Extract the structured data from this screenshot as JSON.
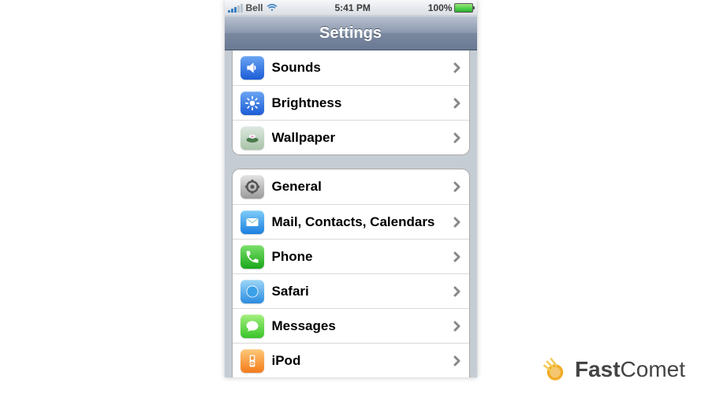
{
  "status_bar": {
    "carrier": "Bell",
    "time": "5:41 PM",
    "battery_pct": "100%"
  },
  "nav": {
    "title": "Settings"
  },
  "groups": [
    {
      "rows": [
        {
          "id": "sounds",
          "label": "Sounds",
          "icon": "sounds-icon"
        },
        {
          "id": "brightness",
          "label": "Brightness",
          "icon": "brightness-icon"
        },
        {
          "id": "wallpaper",
          "label": "Wallpaper",
          "icon": "wallpaper-icon"
        }
      ]
    },
    {
      "rows": [
        {
          "id": "general",
          "label": "General",
          "icon": "general-icon"
        },
        {
          "id": "mail",
          "label": "Mail, Contacts, Calendars",
          "icon": "mail-icon"
        },
        {
          "id": "phone",
          "label": "Phone",
          "icon": "phone-icon"
        },
        {
          "id": "safari",
          "label": "Safari",
          "icon": "safari-icon"
        },
        {
          "id": "messages",
          "label": "Messages",
          "icon": "messages-icon"
        },
        {
          "id": "ipod",
          "label": "iPod",
          "icon": "ipod-icon"
        }
      ]
    }
  ],
  "watermark": {
    "brand_bold": "Fast",
    "brand_light": "Comet"
  }
}
